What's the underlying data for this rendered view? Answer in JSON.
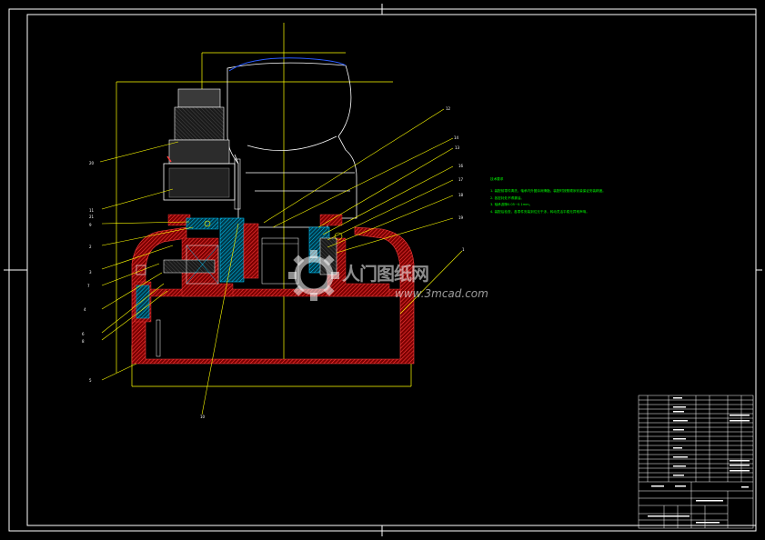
{
  "drawing": {
    "part_callouts": [
      "12",
      "14",
      "13",
      "16",
      "17",
      "18",
      "19",
      "1",
      "2",
      "3",
      "4",
      "5",
      "6",
      "7",
      "8",
      "9",
      "10",
      "11",
      "20",
      "21"
    ],
    "watermark": {
      "brand": "人门图纸网",
      "site": "www.3mcad.com"
    },
    "technical_notes": {
      "heading": "技术要求",
      "lines": [
        "1. 装配前零件清洗，轴承内外圈涂润滑脂，装配时按照顺序安装保证安装精度。",
        "2. 各密封处不得漏油。",
        "3. 轴承游隙0.05~0.1mm。",
        "4. 装配后检查，各零件安装到位无干涉，转动灵活平稳无异常声响。"
      ]
    },
    "colors": {
      "background": "#000000",
      "frame": "#ffffff",
      "housing": "#cc2a2a",
      "centerline": "#ffff00",
      "outline": "#ffffff",
      "hatch_cyan": "#00c8ff",
      "notes": "#00ff00",
      "blue_profile": "#2a5cff"
    }
  }
}
